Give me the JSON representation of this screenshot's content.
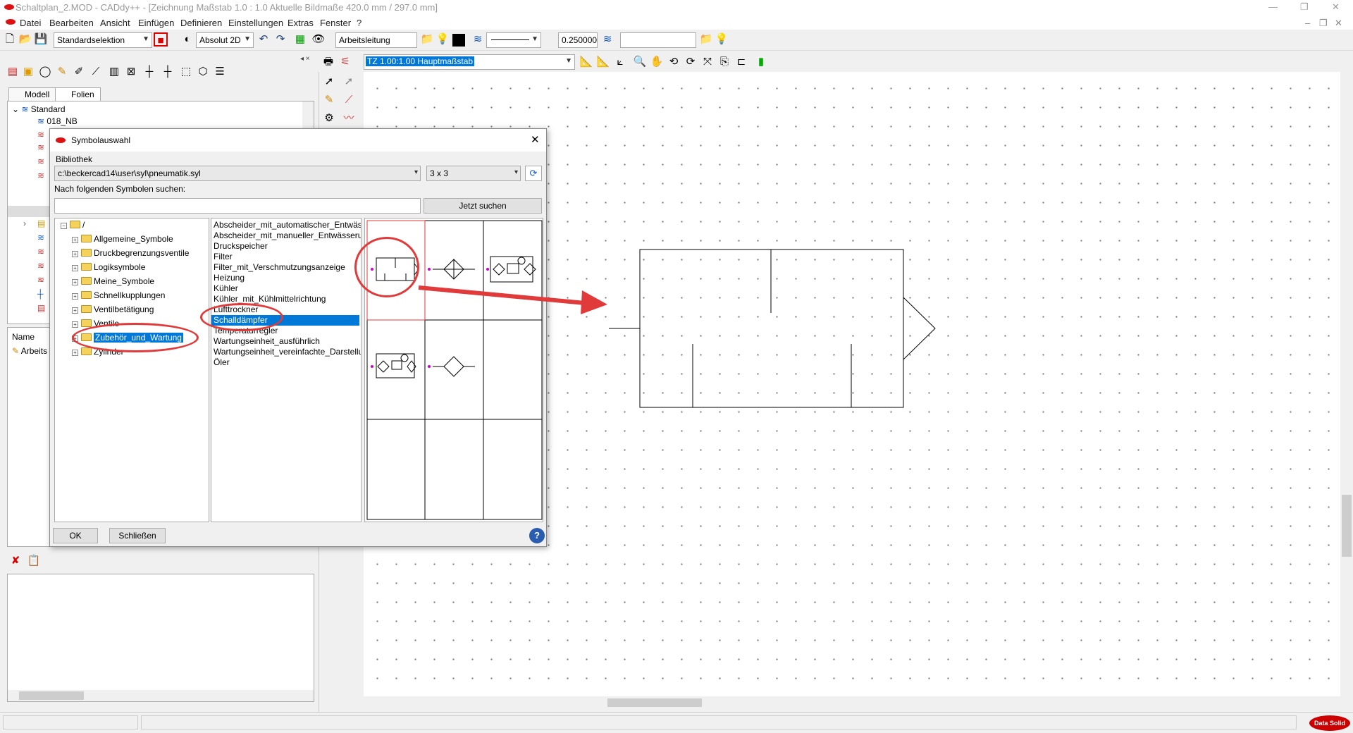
{
  "window": {
    "title": "Schaltplan_2.MOD   -  CADdy++ - [Zeichnung    Maßstab 1.0 : 1.0    Aktuelle Bildmaße 420.0 mm / 297.0 mm]"
  },
  "menu": [
    "Datei",
    "Bearbeiten",
    "Ansicht",
    "Einfügen",
    "Definieren",
    "Einstellungen",
    "Extras",
    "Fenster",
    "?"
  ],
  "toolbar": {
    "selection": "Standardselektion",
    "mode": "Absolut 2D",
    "layer": "Arbeitsleitung",
    "lineweight": "0.250000",
    "scale": "TZ 1.00:1.00 Hauptmaßstab"
  },
  "left_tabs": [
    "Modell",
    "Folien"
  ],
  "layers": {
    "root": "Standard",
    "first": "018_NB"
  },
  "props": {
    "header": "Name",
    "row": "Arbeits"
  },
  "dialog": {
    "title": "Symbolauswahl",
    "library_label": "Bibliothek",
    "library_path": "c:\\beckercad14\\user\\syl\\pneumatik.syl",
    "grid_size": "3 x 3",
    "search_label": "Nach folgenden Symbolen suchen:",
    "search_value": "",
    "search_button": "Jetzt suchen",
    "root": "/",
    "folders": [
      "Allgemeine_Symbole",
      "Druckbegrenzungsventile",
      "Logiksymbole",
      "Meine_Symbole",
      "Schnellkupplungen",
      "Ventilbetätigung",
      "Ventile",
      "Zubehör_und_Wartung",
      "Zylinder"
    ],
    "selected_folder": "Zubehör_und_Wartung",
    "symbols": [
      "Abscheider_mit_automatischer_Entwäs:",
      "Abscheider_mit_manueller_Entwässerur",
      "Druckspeicher",
      "Filter",
      "Filter_mit_Verschmutzungsanzeige",
      "Heizung",
      "Kühler",
      "Kühler_mit_Kühlmittelrichtung",
      "Lufttrockner",
      "Schalldämpfer",
      "Temperaturregler",
      "Wartungseinheit_ausführlich",
      "Wartungseinheit_vereinfachte_Darstellu",
      "Öler"
    ],
    "selected_symbol": "Schalldämpfer",
    "ok": "OK",
    "close": "Schließen",
    "help": "?"
  },
  "branding": "Data Solid",
  "colors": {
    "accent_red": "#e03a3a",
    "selection_blue": "#0078d7"
  }
}
